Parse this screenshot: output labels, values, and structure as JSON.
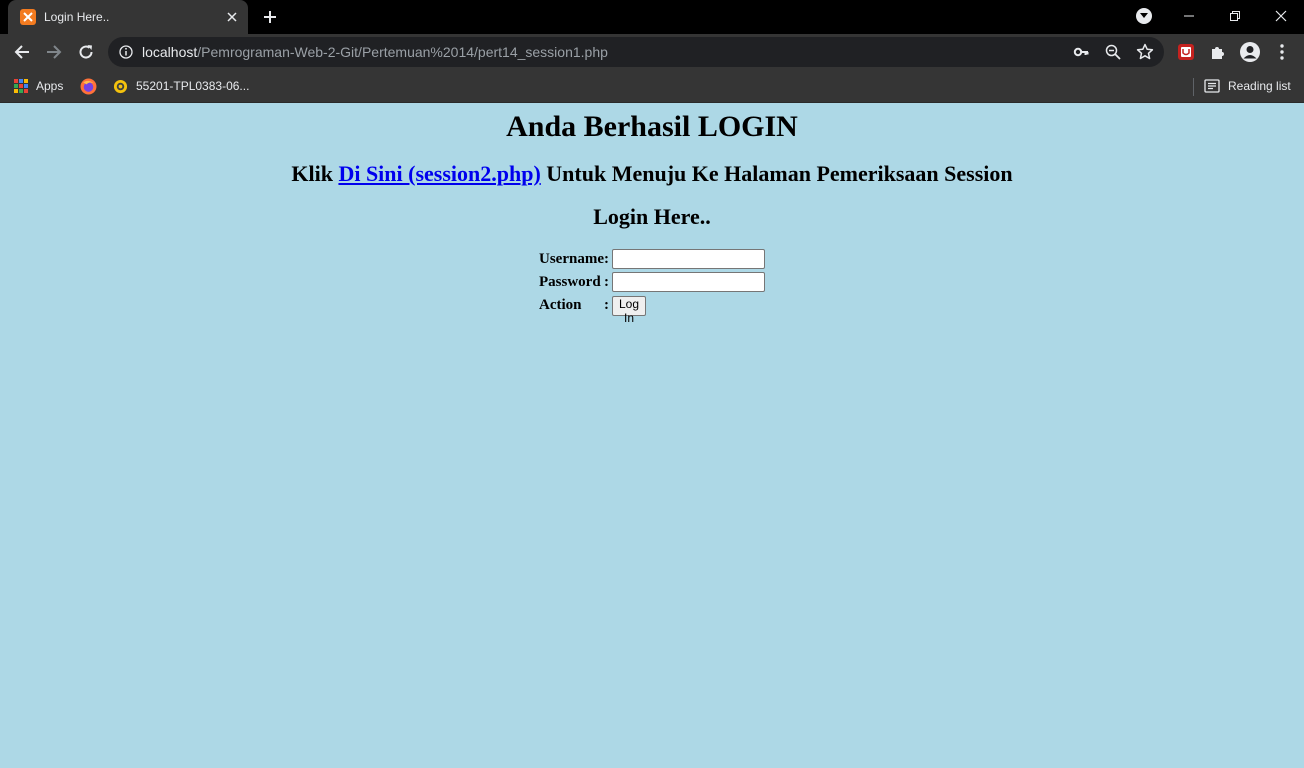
{
  "browser": {
    "tab_title": "Login Here..",
    "url_host": "localhost",
    "url_path": "/Pemrograman-Web-2-Git/Pertemuan%2014/pert14_session1.php",
    "bookmarks": {
      "apps_label": "Apps",
      "item_label": "55201-TPL0383-06...",
      "reading_list_label": "Reading list"
    }
  },
  "page": {
    "heading": "Anda Berhasil LOGIN",
    "link_prefix": "Klik ",
    "link_text": "Di Sini (session2.php)",
    "link_suffix": " Untuk Menuju Ke Halaman Pemeriksaan Session",
    "login_title": "Login Here..",
    "form": {
      "username_label": "Username",
      "password_label": "Password",
      "action_label": "Action",
      "separator": ":",
      "username_value": "",
      "password_value": "",
      "login_button": "Log In"
    }
  },
  "colors": {
    "page_background": "#add8e6",
    "link": "#0000ee",
    "chrome_dark": "#353535"
  }
}
